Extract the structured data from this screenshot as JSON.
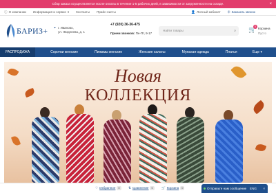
{
  "announcement": {
    "text": "Сбор заказа осуществляется после оплаты в течение 1-5 рабочих дней, в зависимости от загруженности на складе.",
    "close": "×"
  },
  "top_links": {
    "left": [
      "О компании",
      "Информация и сервис",
      "Контакты",
      "Прайс-листы"
    ],
    "account": "Личный кабинет",
    "login": "Заказать звонок"
  },
  "logo": {
    "text": "БАРИЗ+"
  },
  "address": {
    "line1": "г. Иваново,",
    "line2": "ул. Жиделева, д. 1"
  },
  "phone": "+7 (920) 36-36-475",
  "hours": {
    "label": "Прием звонков:",
    "value": "Пн-Пт, 9-17"
  },
  "search": {
    "placeholder": "Найти товары"
  },
  "cart": {
    "label": "Корзина",
    "sub": "Пусто",
    "count": "0"
  },
  "nav": [
    "РАСПРОДАЖА",
    "Сорочки женские",
    "Пижамы женские",
    "Женские халаты",
    "Мужская одежда",
    "Платья",
    "Еще"
  ],
  "banner": {
    "title1": "Новая",
    "title2": "КОЛЛЕКЦИЯ"
  },
  "bottombar": {
    "favorites": "Избранное",
    "favorites_count": "0",
    "compare": "Сравнение",
    "compare_count": "0",
    "cart": "Корзина",
    "cart_count": "0"
  },
  "chat": {
    "text": "Отправьте нам сообщение",
    "lang": "ENG",
    "close": "×"
  },
  "colors": {
    "accent": "#e23c6c",
    "brand": "#1f4f8c"
  }
}
